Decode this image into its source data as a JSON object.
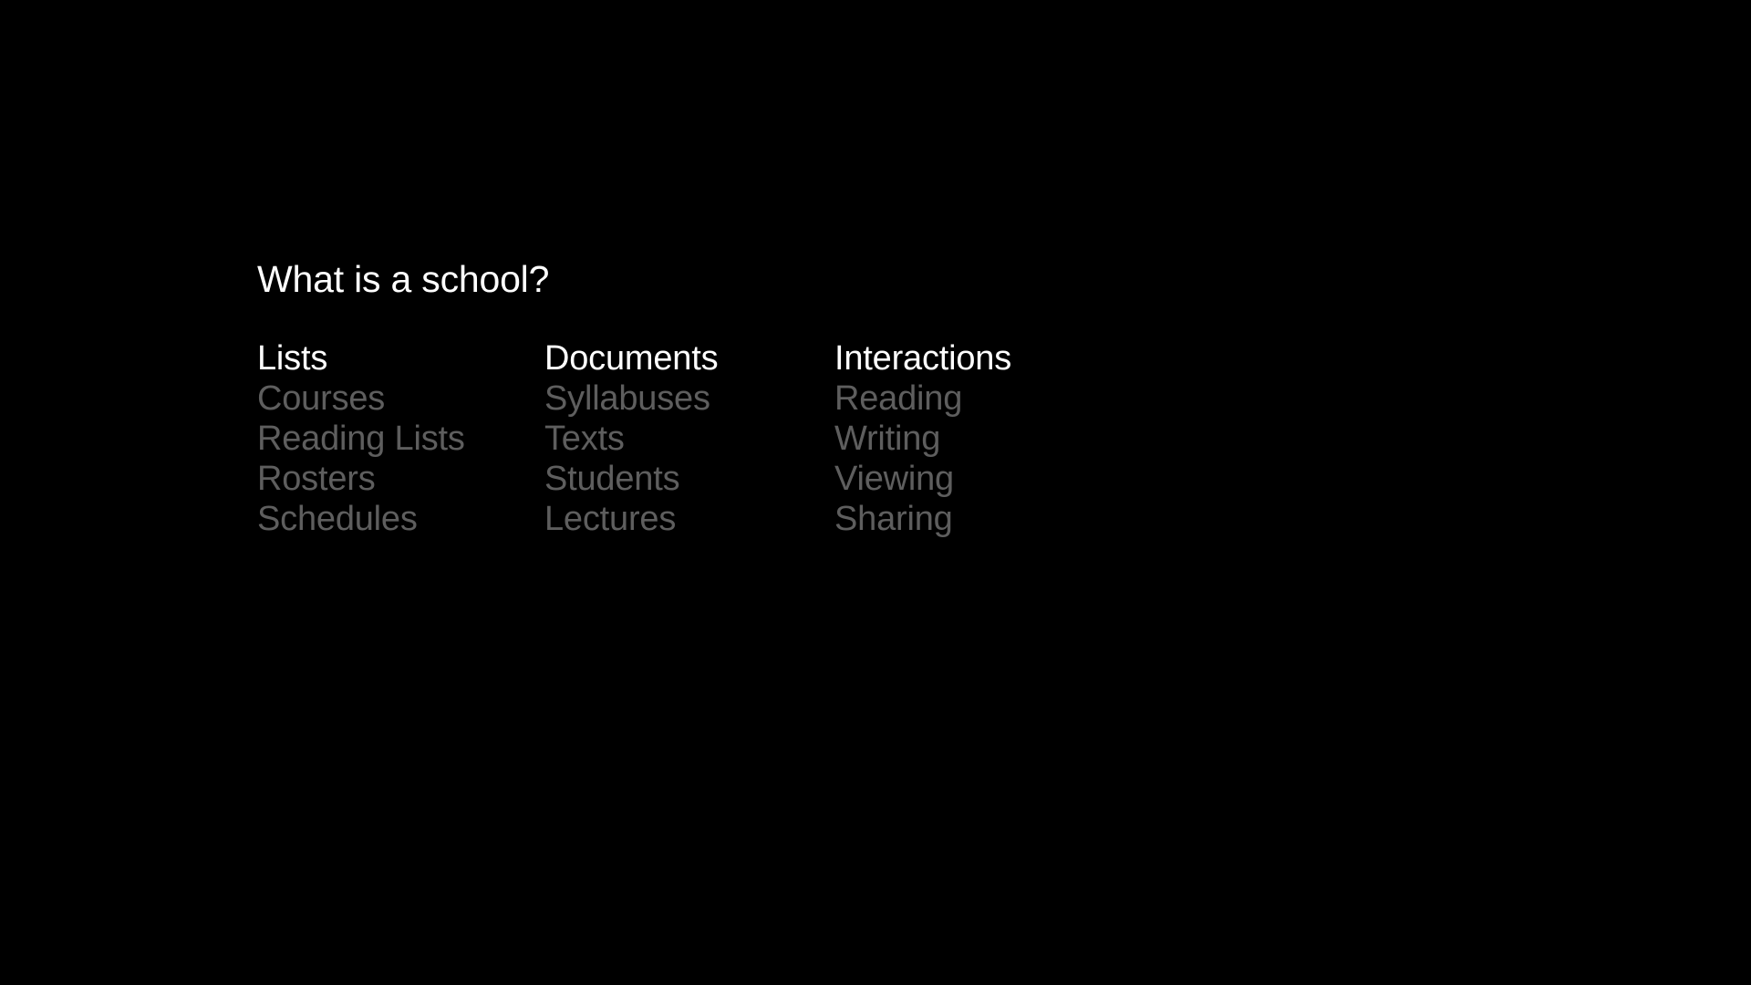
{
  "slide": {
    "background_color": "#000000",
    "title": "What is a school?",
    "heading_color": "#ffffff",
    "item_color": "#5e5e5e",
    "columns": [
      {
        "heading": "Lists",
        "items": [
          "Courses",
          "Reading Lists",
          "Rosters",
          "Schedules"
        ]
      },
      {
        "heading": "Documents",
        "items": [
          "Syllabuses",
          "Texts",
          "Students",
          "Lectures"
        ]
      },
      {
        "heading": "Interactions",
        "items": [
          "Reading",
          "Writing",
          "Viewing",
          "Sharing"
        ]
      }
    ]
  }
}
